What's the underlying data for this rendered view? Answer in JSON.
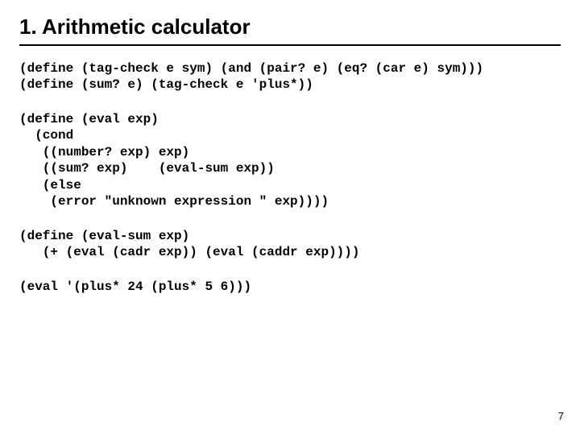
{
  "title": "1. Arithmetic calculator",
  "code_block_1": "(define (tag-check e sym) (and (pair? e) (eq? (car e) sym)))\n(define (sum? e) (tag-check e 'plus*))",
  "code_block_2": "(define (eval exp)\n  (cond\n   ((number? exp) exp)\n   ((sum? exp)    (eval-sum exp))\n   (else\n    (error \"unknown expression \" exp))))",
  "code_block_3": "(define (eval-sum exp)\n   (+ (eval (cadr exp)) (eval (caddr exp))))",
  "code_block_4": "(eval '(plus* 24 (plus* 5 6)))",
  "page_number": "7"
}
